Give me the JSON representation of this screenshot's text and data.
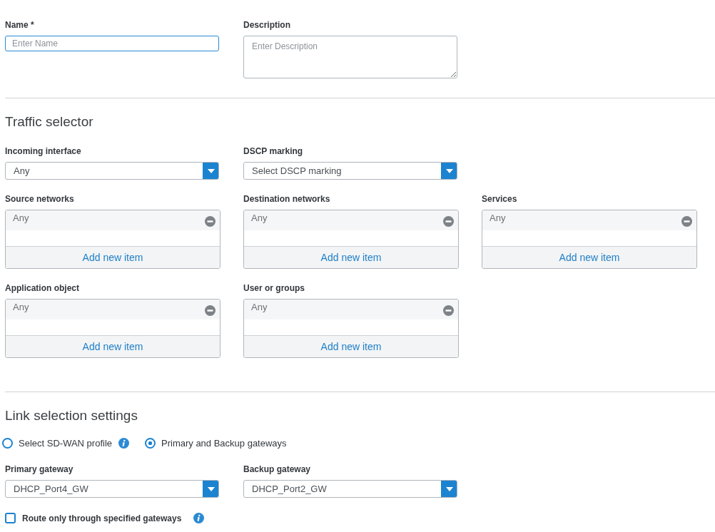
{
  "name_field": {
    "label": "Name *",
    "placeholder": "Enter Name",
    "focused": true
  },
  "description_field": {
    "label": "Description",
    "placeholder": "Enter Description"
  },
  "traffic_selector": {
    "title": "Traffic selector",
    "dropdowns": [
      {
        "label": "Incoming interface",
        "value": "Any"
      },
      {
        "label": "DSCP marking",
        "value": "Select DSCP marking"
      }
    ],
    "lists": [
      {
        "label": "Source networks",
        "item": "Any",
        "add_label": "Add new item"
      },
      {
        "label": "Destination networks",
        "item": "Any",
        "add_label": "Add new item"
      },
      {
        "label": "Services",
        "item": "Any",
        "add_label": "Add new item"
      },
      {
        "label": "Application object",
        "item": "Any",
        "add_label": "Add new item"
      },
      {
        "label": "User or groups",
        "item": "Any",
        "add_label": "Add new item"
      }
    ]
  },
  "link_selection": {
    "title": "Link selection settings",
    "modes": [
      {
        "label": "Select SD-WAN profile",
        "selected": false,
        "info": true
      },
      {
        "label": "Primary and Backup gateways",
        "selected": true,
        "info": false
      }
    ],
    "dropdowns": [
      {
        "label": "Primary gateway",
        "value": "DHCP_Port4_GW"
      },
      {
        "label": "Backup gateway",
        "value": "DHCP_Port2_GW"
      }
    ],
    "route_only": {
      "label": "Route only through specified gateways",
      "checked": false,
      "info": true
    }
  }
}
